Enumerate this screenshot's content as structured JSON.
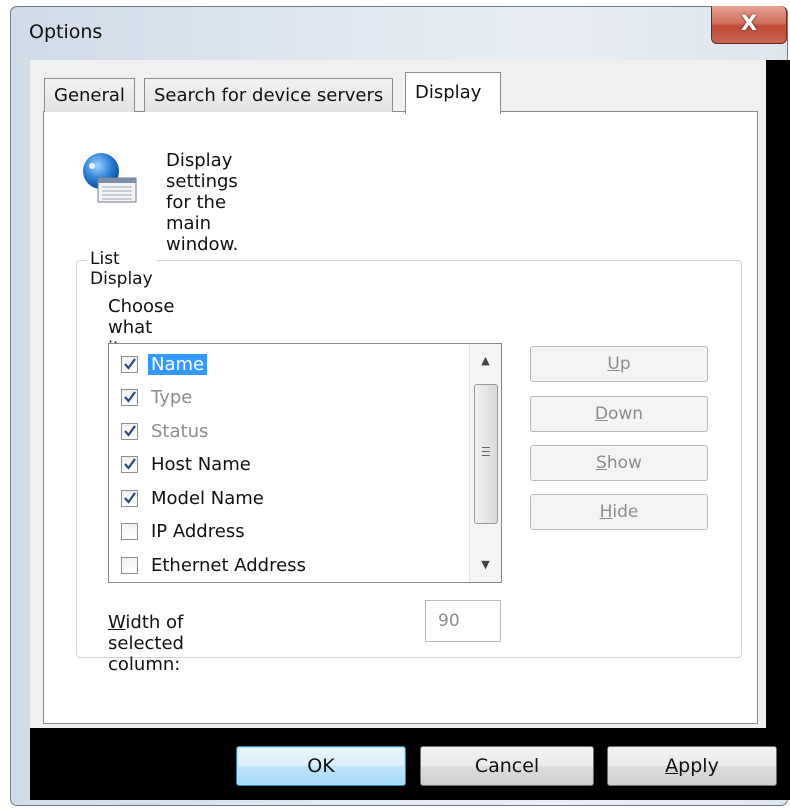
{
  "window": {
    "title": "Options",
    "close_glyph": "X"
  },
  "tabs": [
    {
      "label": "General",
      "active": false
    },
    {
      "label": "Search for device servers",
      "active": false
    },
    {
      "label": "Display",
      "active": true
    }
  ],
  "panel": {
    "icon": "display-settings-icon",
    "description": "Display settings for the main window.",
    "group": {
      "label": "List Display",
      "instruction": "Choose what items to display in the USB device list.",
      "items": [
        {
          "label": "Name",
          "checked": true,
          "enabled": true,
          "selected": true
        },
        {
          "label": "Type",
          "checked": true,
          "enabled": false,
          "selected": false
        },
        {
          "label": "Status",
          "checked": true,
          "enabled": false,
          "selected": false
        },
        {
          "label": "Host Name",
          "checked": true,
          "enabled": true,
          "selected": false
        },
        {
          "label": "Model Name",
          "checked": true,
          "enabled": true,
          "selected": false
        },
        {
          "label": "IP Address",
          "checked": false,
          "enabled": true,
          "selected": false
        },
        {
          "label": "Ethernet Address",
          "checked": false,
          "enabled": true,
          "selected": false
        }
      ],
      "buttons": {
        "up": {
          "mnemonic": "U",
          "rest": "p"
        },
        "down": {
          "mnemonic": "D",
          "rest": "own"
        },
        "show": {
          "mnemonic": "S",
          "rest": "how"
        },
        "hide": {
          "mnemonic": "H",
          "rest": "ide"
        }
      },
      "width_label_mnemonic": "W",
      "width_label_rest": "idth of selected column:",
      "width_value": "90"
    }
  },
  "footer": {
    "ok": "OK",
    "cancel": "Cancel",
    "apply_mnemonic": "A",
    "apply_rest": "pply"
  },
  "colors": {
    "selection": "#3399ff",
    "default_button": "#bee6fd",
    "close_button": "#c7503c"
  }
}
